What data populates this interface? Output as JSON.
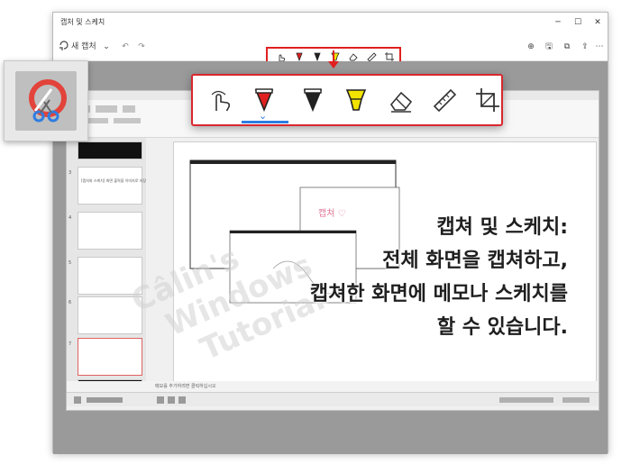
{
  "window": {
    "title": "캡처 및 스케치",
    "new_capture": "새 캡처",
    "minimize": "─",
    "maximize": "☐",
    "close": "✕"
  },
  "toolbar": {
    "new_capture_icon": "new-capture-icon",
    "dropdown": "⌄",
    "undo": "↶",
    "redo": "↷",
    "zoom": "⊕",
    "save": "🖫",
    "copy": "⧉",
    "share": "⇪",
    "more": "⋯"
  },
  "tools": [
    "touch-writing",
    "ballpoint-pen",
    "pencil",
    "highlighter",
    "eraser",
    "ruler",
    "crop"
  ],
  "colors": {
    "highlight_border": "#e02020",
    "selected_underline": "#2f7de1",
    "pen_red": "#e02020",
    "highlighter_yellow": "#f2e400"
  },
  "caption": {
    "line1": "캡쳐 및 스케치:",
    "line2": "전체 화면을 캡쳐하고,",
    "line3": "캡쳐한 화면에 메모나 스케치를",
    "line4": "할 수 있습니다."
  },
  "watermark": {
    "line1": "Câlin's",
    "line2": "Windows",
    "line3": "Tutorial"
  },
  "inner": {
    "thumb_numbers": [
      "3",
      "4",
      "5",
      "6",
      "7"
    ],
    "thumb_text": "[캡처와 스케치] 화면 출력을 이미지로 저장",
    "sketch_text": "캡쳐 ♡",
    "status_text": "메모를 추가하려면 클릭하십시오"
  }
}
